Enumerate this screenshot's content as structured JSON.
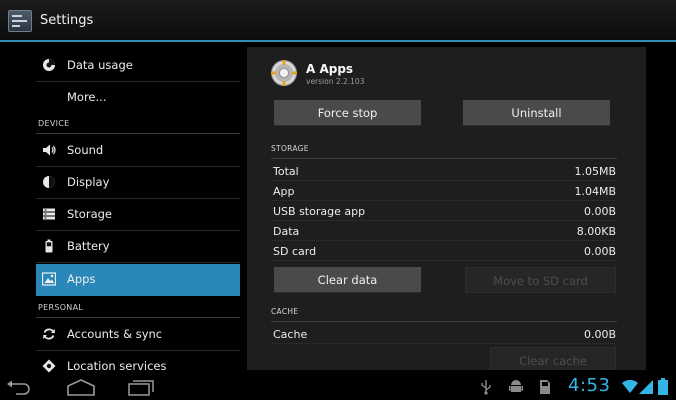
{
  "header": {
    "title": "Settings",
    "icon": "settings-icon"
  },
  "sidebar": {
    "items": [
      {
        "label": "Data usage",
        "icon": "data-usage-icon"
      },
      {
        "label": "More...",
        "icon": ""
      },
      {
        "label": "Sound",
        "icon": "sound-icon"
      },
      {
        "label": "Display",
        "icon": "display-icon"
      },
      {
        "label": "Storage",
        "icon": "storage-icon"
      },
      {
        "label": "Battery",
        "icon": "battery-icon"
      },
      {
        "label": "Apps",
        "icon": "apps-icon",
        "selected": true
      },
      {
        "label": "Accounts & sync",
        "icon": "sync-icon"
      },
      {
        "label": "Location services",
        "icon": "location-icon"
      }
    ],
    "sections": [
      "DEVICE",
      "PERSONAL"
    ]
  },
  "app_info": {
    "name": "A Apps",
    "version": "version 2.2.103",
    "force_stop": "Force stop",
    "uninstall": "Uninstall",
    "storage_header": "STORAGE",
    "storage": [
      {
        "label": "Total",
        "value": "1.05MB"
      },
      {
        "label": "App",
        "value": "1.04MB"
      },
      {
        "label": "USB storage app",
        "value": "0.00B"
      },
      {
        "label": "Data",
        "value": "8.00KB"
      },
      {
        "label": "SD card",
        "value": "0.00B"
      }
    ],
    "clear_data": "Clear data",
    "move_to_sd": "Move to SD card",
    "cache_header": "CACHE",
    "cache": {
      "label": "Cache",
      "value": "0.00B"
    },
    "clear_cache": "Clear cache"
  },
  "system_bar": {
    "time": "4:53",
    "accent": "#33b5e5",
    "nav_icons": [
      "back-icon",
      "home-icon",
      "recent-apps-icon"
    ],
    "status_icons": [
      "usb-icon",
      "android-debug-icon",
      "sd-card-icon",
      "wifi-icon",
      "signal-icon",
      "battery-icon"
    ]
  },
  "colors": {
    "selection": "#2a87ba",
    "header_line": "#2e8db8"
  }
}
